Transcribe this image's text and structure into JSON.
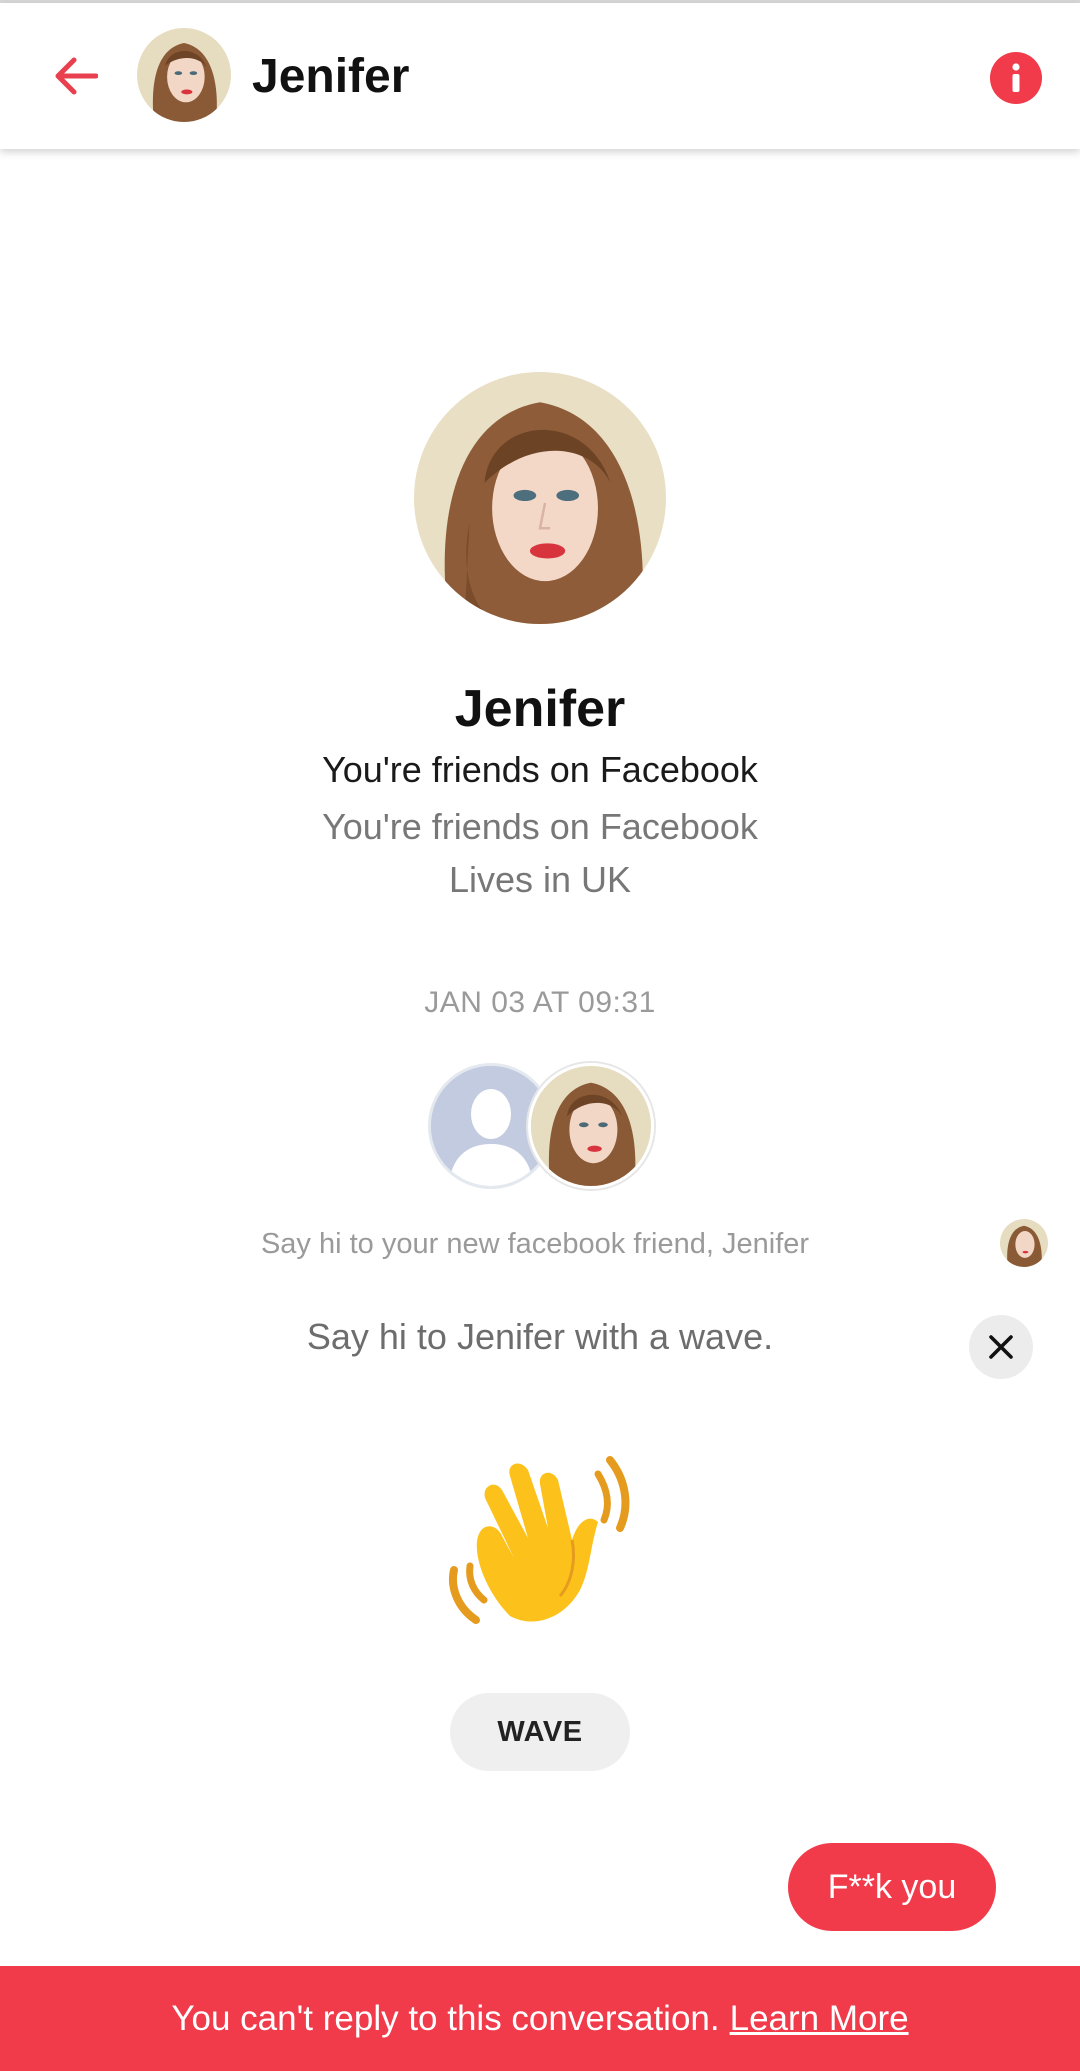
{
  "header": {
    "contact_name": "Jenifer",
    "back_icon": "arrow-left-icon",
    "info_icon": "info-icon"
  },
  "profile": {
    "name": "Jenifer",
    "line1": "You're friends on Facebook",
    "line2": "You're friends on Facebook",
    "line3": "Lives in UK"
  },
  "conversation": {
    "timestamp": "JAN 03 AT 09:31",
    "system_message": "Say hi to your new facebook friend, Jenifer",
    "wave_prompt": "Say hi to Jenifer with a wave.",
    "wave_button_label": "WAVE",
    "sent_message": "F**k you"
  },
  "footer": {
    "notice": "You can't reply to this conversation.",
    "link_label": "Learn More"
  },
  "colors": {
    "accent": "#f13a4a",
    "placeholder_avatar": "#c3cbe0"
  }
}
